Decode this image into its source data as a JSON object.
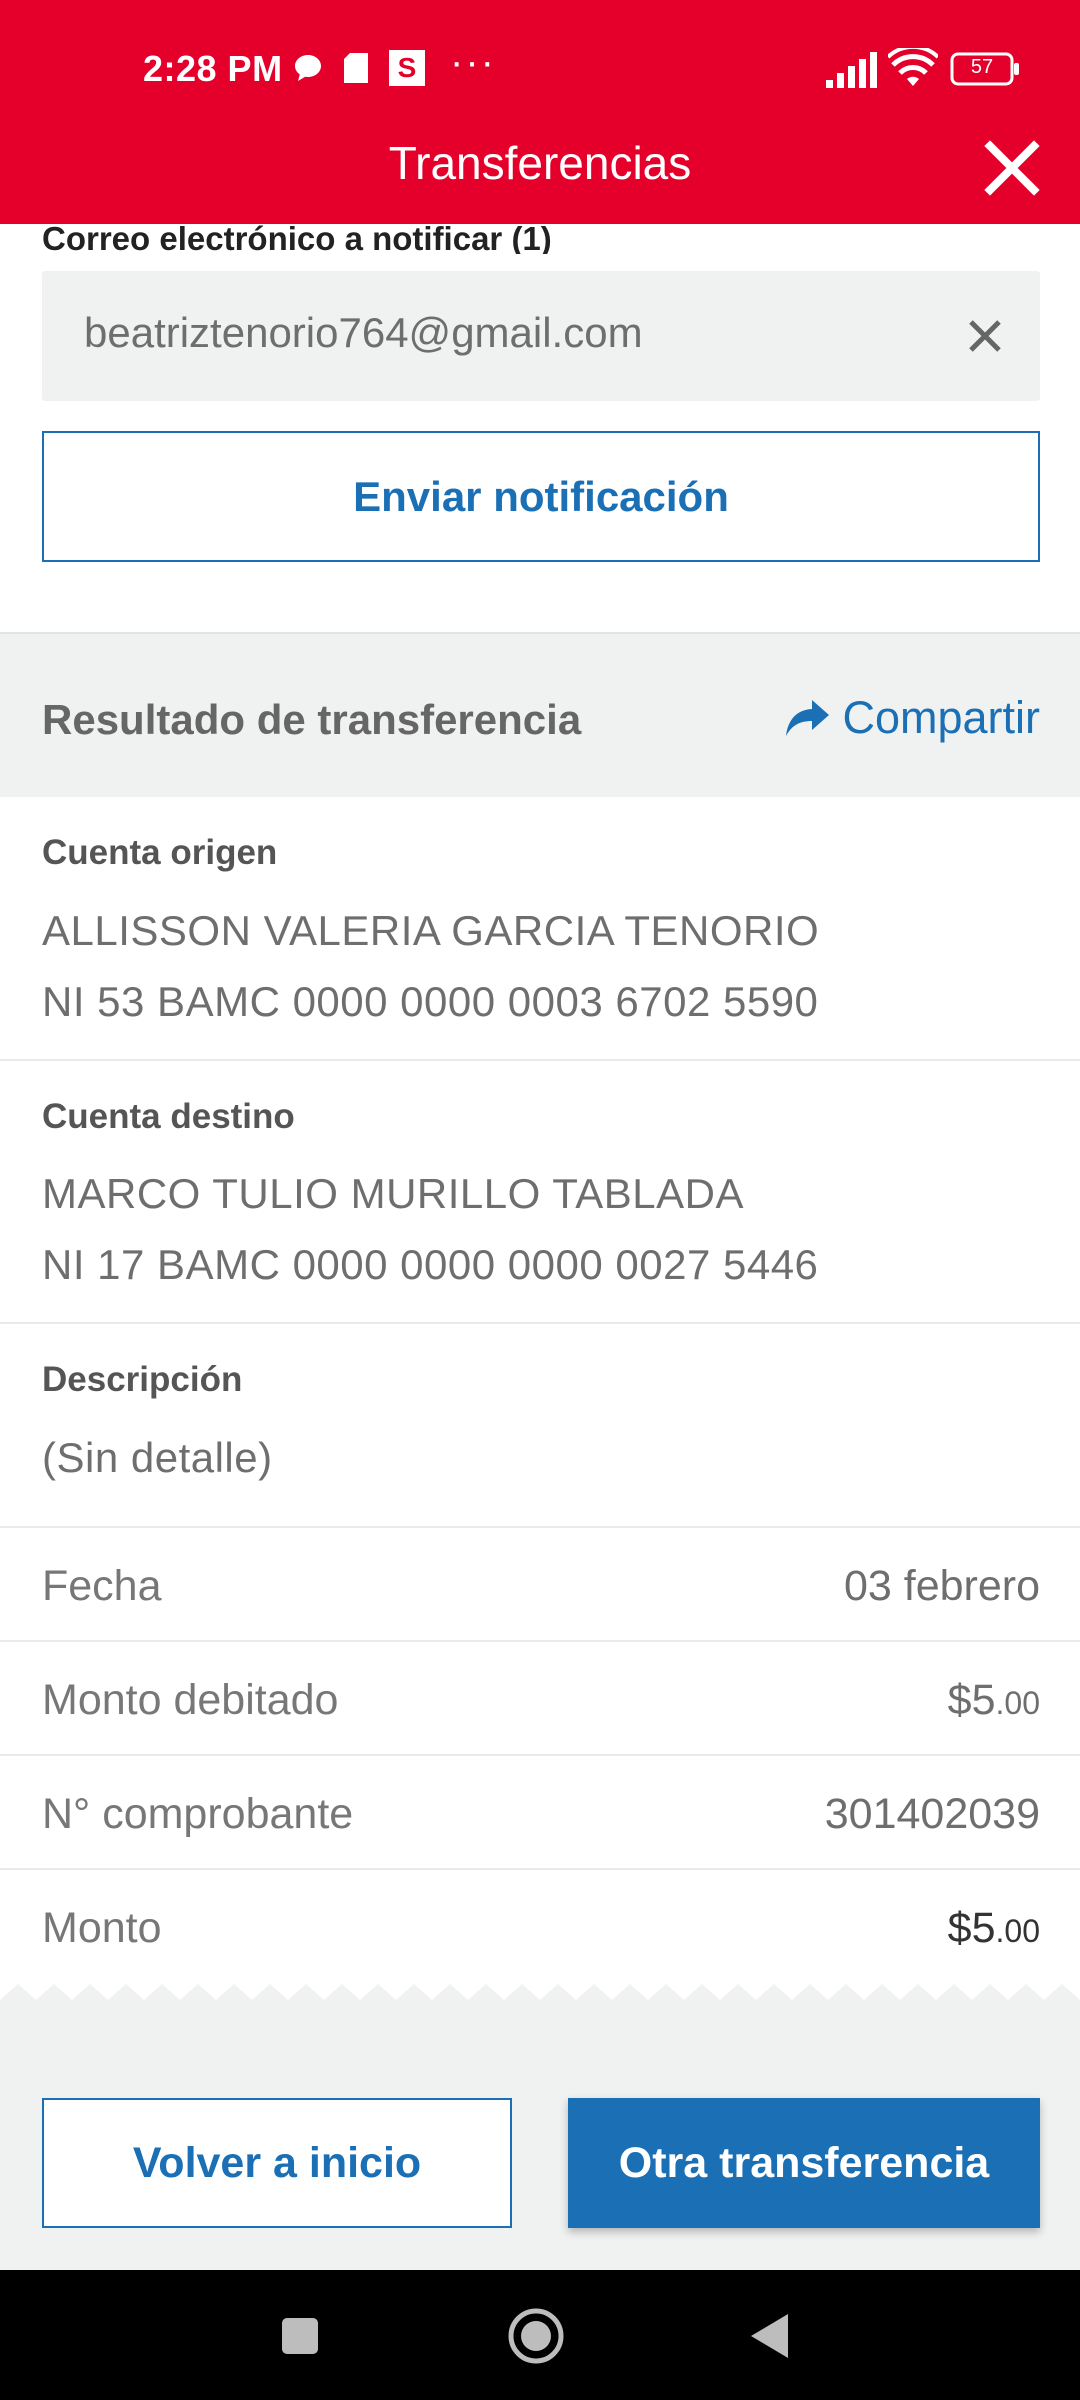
{
  "status_bar": {
    "time": "2:28 PM",
    "notif_s": "S",
    "more": "···",
    "battery": "57",
    "icons": [
      "chat-bubble-icon",
      "sim-card-icon",
      "s-app-icon",
      "more-icon",
      "signal-icon",
      "wifi-icon",
      "battery-icon"
    ]
  },
  "header": {
    "title": "Transferencias",
    "close_icon": "close-icon"
  },
  "notification": {
    "label": "Correo electrónico a notificar (1)",
    "email_value": "beatriztenorio764@gmail.com",
    "clear_icon": "close-icon",
    "send_button": "Enviar notificación"
  },
  "result": {
    "title": "Resultado de transferencia",
    "share_label": "Compartir",
    "share_icon": "share-arrow-icon",
    "origin": {
      "label": "Cuenta origen",
      "name": "ALLISSON VALERIA GARCIA TENORIO",
      "account": "NI 53 BAMC 0000 0000 0003 6702 5590"
    },
    "destination": {
      "label": "Cuenta destino",
      "name": "MARCO TULIO MURILLO TABLADA",
      "account": "NI 17 BAMC 0000 0000 0000 0027 5446"
    },
    "description": {
      "label": "Descripción",
      "value": "(Sin detalle)"
    },
    "rows": {
      "date": {
        "label": "Fecha",
        "value": "03 febrero"
      },
      "debited": {
        "label": "Monto debitado",
        "main": "$5",
        "cents": ".00"
      },
      "voucher": {
        "label": "N° comprobante",
        "value": "301402039"
      },
      "amount": {
        "label": "Monto",
        "main": "$5",
        "cents": ".00"
      }
    }
  },
  "actions": {
    "home_button": "Volver a inicio",
    "another_button": "Otra transferencia"
  },
  "nav_bar": {
    "icons": [
      "recent-apps-icon",
      "home-icon",
      "back-icon"
    ]
  },
  "colors": {
    "brand_red": "#e4002b",
    "accent_blue": "#1a6fb5",
    "panel_gray": "#f0f1f1"
  }
}
